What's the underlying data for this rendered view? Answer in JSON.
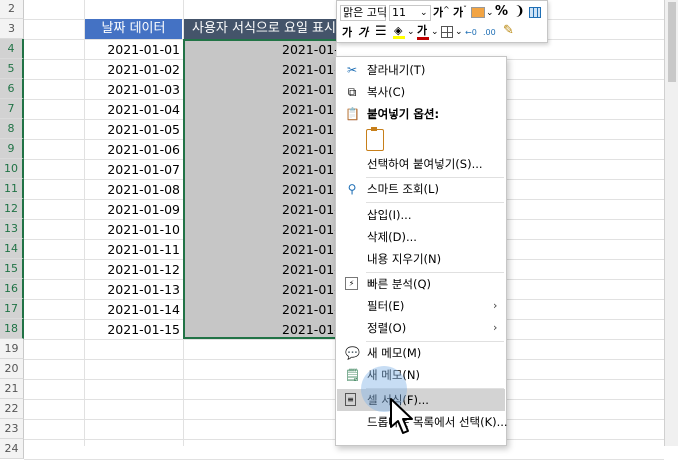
{
  "row_numbers": [
    "2",
    "3",
    "4",
    "5",
    "6",
    "7",
    "8",
    "9",
    "10",
    "11",
    "12",
    "13",
    "14",
    "15",
    "16",
    "17",
    "18",
    "19",
    "20",
    "21",
    "22",
    "23",
    "24"
  ],
  "headers": {
    "date_col": "날짜 데이터",
    "custom_col": "사용자 서식으로 요일 표시"
  },
  "dates": [
    "2021-01-01",
    "2021-01-02",
    "2021-01-03",
    "2021-01-04",
    "2021-01-05",
    "2021-01-06",
    "2021-01-07",
    "2021-01-08",
    "2021-01-09",
    "2021-01-10",
    "2021-01-11",
    "2021-01-12",
    "2021-01-13",
    "2021-01-14",
    "2021-01-15"
  ],
  "custom_values": [
    "2021-01-0",
    "2021-01-0",
    "2021-01-0",
    "2021-01-0",
    "2021-01-0",
    "2021-01-0",
    "2021-01-0",
    "2021-01-0",
    "2021-01-0",
    "2021-01-1",
    "2021-01-1",
    "2021-01-1",
    "2021-01-1",
    "2021-01-1",
    "2021-01-1"
  ],
  "colors": {
    "header_blue": "#4472c4",
    "header_dark": "#44546a",
    "selection": "#c6c6c6",
    "excel_green": "#217346"
  },
  "mini_toolbar": {
    "font_name": "맑은 고딕",
    "font_size": "11",
    "grow_font": "가",
    "shrink_font": "가",
    "percent": "%",
    "comma": "❩",
    "bold": "가",
    "italic": "가",
    "font_color_letter": "가"
  },
  "context_menu": {
    "cut": "잘라내기(T)",
    "copy": "복사(C)",
    "paste_options": "붙여넣기 옵션:",
    "paste_special": "선택하여 붙여넣기(S)...",
    "smart_lookup": "스마트 조회(L)",
    "insert": "삽입(I)...",
    "delete": "삭제(D)...",
    "clear_contents": "내용 지우기(N)",
    "quick_analysis": "빠른 분석(Q)",
    "filter": "필터(E)",
    "sort": "정렬(O)",
    "new_comment": "새 메모(M)",
    "new_note": "새 메모(N)",
    "format_cells": "셀 서식(F)...",
    "pick_from_list": "드롭다운 목록에서 선택(K)..."
  }
}
